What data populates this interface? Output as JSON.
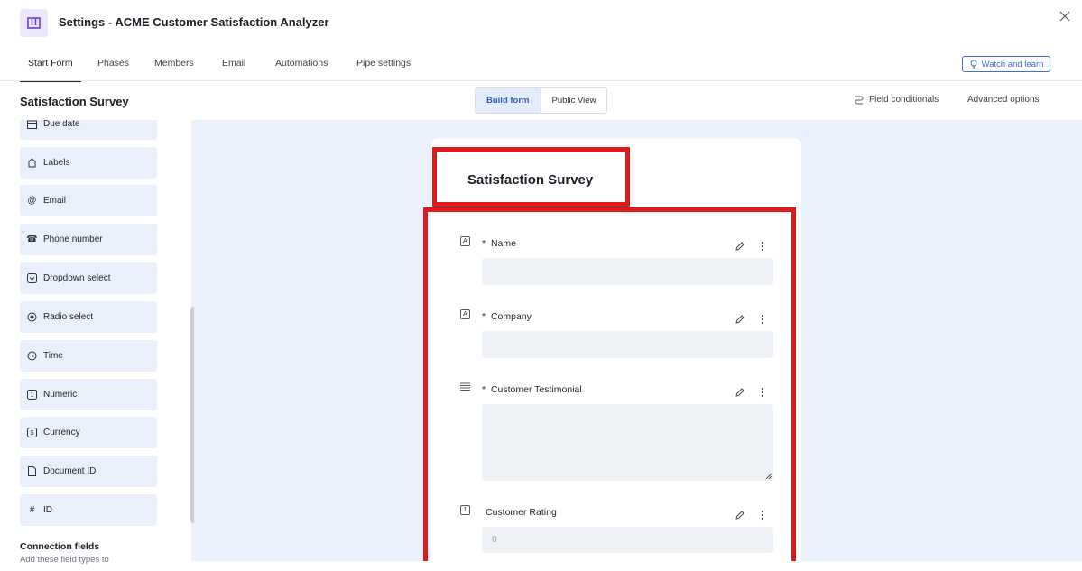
{
  "header": {
    "title": "Settings - ACME Customer Satisfaction Analyzer",
    "close_icon": "close-icon"
  },
  "tabs": [
    {
      "label": "Start Form",
      "active": true
    },
    {
      "label": "Phases"
    },
    {
      "label": "Members"
    },
    {
      "label": "Email"
    },
    {
      "label": "Automations"
    },
    {
      "label": "Pipe settings"
    }
  ],
  "watch_learn": {
    "label": "Watch and learn",
    "icon": "lightbulb-icon"
  },
  "subheader": {
    "form_title": "Satisfaction Survey",
    "segments": [
      {
        "label": "Build form",
        "active": true
      },
      {
        "label": "Public View"
      }
    ],
    "field_conditionals": "Field conditionals",
    "advanced_options": "Advanced options"
  },
  "sidebar": {
    "field_types": [
      {
        "label": "Due date",
        "icon": "calendar-icon"
      },
      {
        "label": "Labels",
        "icon": "tag-icon"
      },
      {
        "label": "Email",
        "icon": "at-icon"
      },
      {
        "label": "Phone number",
        "icon": "phone-icon"
      },
      {
        "label": "Dropdown select",
        "icon": "dropdown-icon"
      },
      {
        "label": "Radio select",
        "icon": "radio-icon"
      },
      {
        "label": "Time",
        "icon": "clock-icon"
      },
      {
        "label": "Numeric",
        "icon": "numeric-icon"
      },
      {
        "label": "Currency",
        "icon": "currency-icon"
      },
      {
        "label": "Document ID",
        "icon": "document-icon"
      },
      {
        "label": "ID",
        "icon": "hash-icon"
      }
    ],
    "connection_title": "Connection fields",
    "connection_sub": "Add these field types to"
  },
  "form": {
    "title": "Satisfaction Survey",
    "fields": [
      {
        "label": "Name",
        "required": true,
        "icon": "text-field-icon",
        "icon_glyph": "A"
      },
      {
        "label": "Company",
        "required": true,
        "icon": "text-field-icon",
        "icon_glyph": "A"
      },
      {
        "label": "Customer Testimonial",
        "required": true,
        "icon": "long-text-icon",
        "icon_glyph": "≣"
      },
      {
        "label": "Customer Rating",
        "required": false,
        "icon": "numeric-icon",
        "icon_glyph": "1",
        "placeholder": "0"
      }
    ],
    "required_marker": "*"
  },
  "colors": {
    "accent": "#3b6fdc",
    "highlight": "#e01a1a",
    "canvas": "#ebf1fc",
    "field_bg": "#e9effb"
  }
}
